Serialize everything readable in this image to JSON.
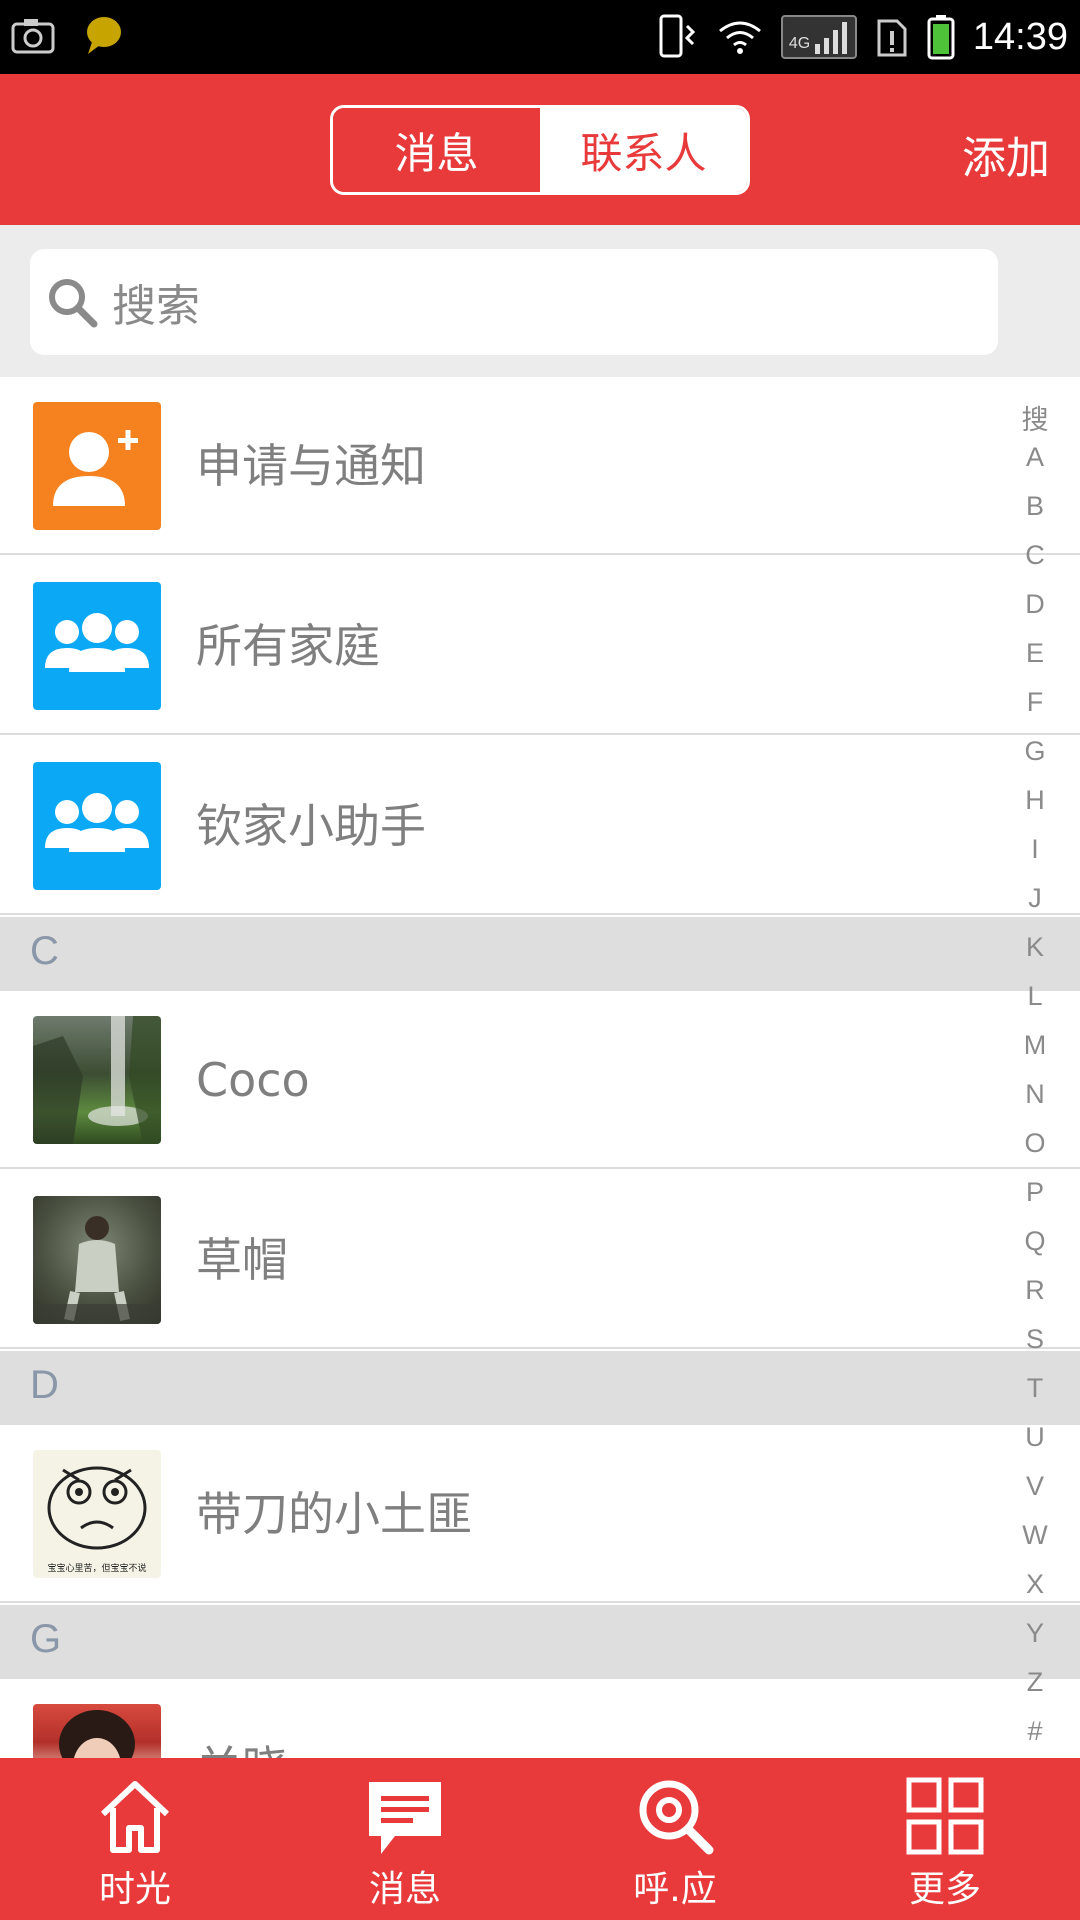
{
  "status_bar": {
    "time": "14:39",
    "network": "4G"
  },
  "header": {
    "tabs": [
      {
        "label": "消息",
        "active": false
      },
      {
        "label": "联系人",
        "active": true
      }
    ],
    "add_label": "添加"
  },
  "search": {
    "placeholder": "搜索"
  },
  "list": {
    "items": [
      {
        "label": "申请与通知",
        "icon": "add-user-icon"
      },
      {
        "label": "所有家庭",
        "icon": "group-icon"
      },
      {
        "label": "钦家小助手",
        "icon": "group-icon"
      }
    ],
    "sections": [
      {
        "letter": "C",
        "contacts": [
          {
            "name": "Coco"
          },
          {
            "name": "草帽"
          }
        ]
      },
      {
        "letter": "D",
        "contacts": [
          {
            "name": "带刀的小土匪"
          }
        ]
      },
      {
        "letter": "G",
        "contacts": [
          {
            "name": "关晓"
          }
        ]
      }
    ],
    "avatar_caption": "宝宝心里苦，但宝宝不说"
  },
  "index_bar": [
    "搜",
    "A",
    "B",
    "C",
    "D",
    "E",
    "F",
    "G",
    "H",
    "I",
    "J",
    "K",
    "L",
    "M",
    "N",
    "O",
    "P",
    "Q",
    "R",
    "S",
    "T",
    "U",
    "V",
    "W",
    "X",
    "Y",
    "Z",
    "#"
  ],
  "bottom_nav": [
    {
      "label": "时光",
      "icon": "home-icon"
    },
    {
      "label": "消息",
      "icon": "message-icon"
    },
    {
      "label": "呼.应",
      "icon": "search-circle-icon"
    },
    {
      "label": "更多",
      "icon": "grid-icon"
    }
  ],
  "colors": {
    "brand": "#e8393b",
    "orange": "#f5821f",
    "blue": "#0aa8f5"
  }
}
